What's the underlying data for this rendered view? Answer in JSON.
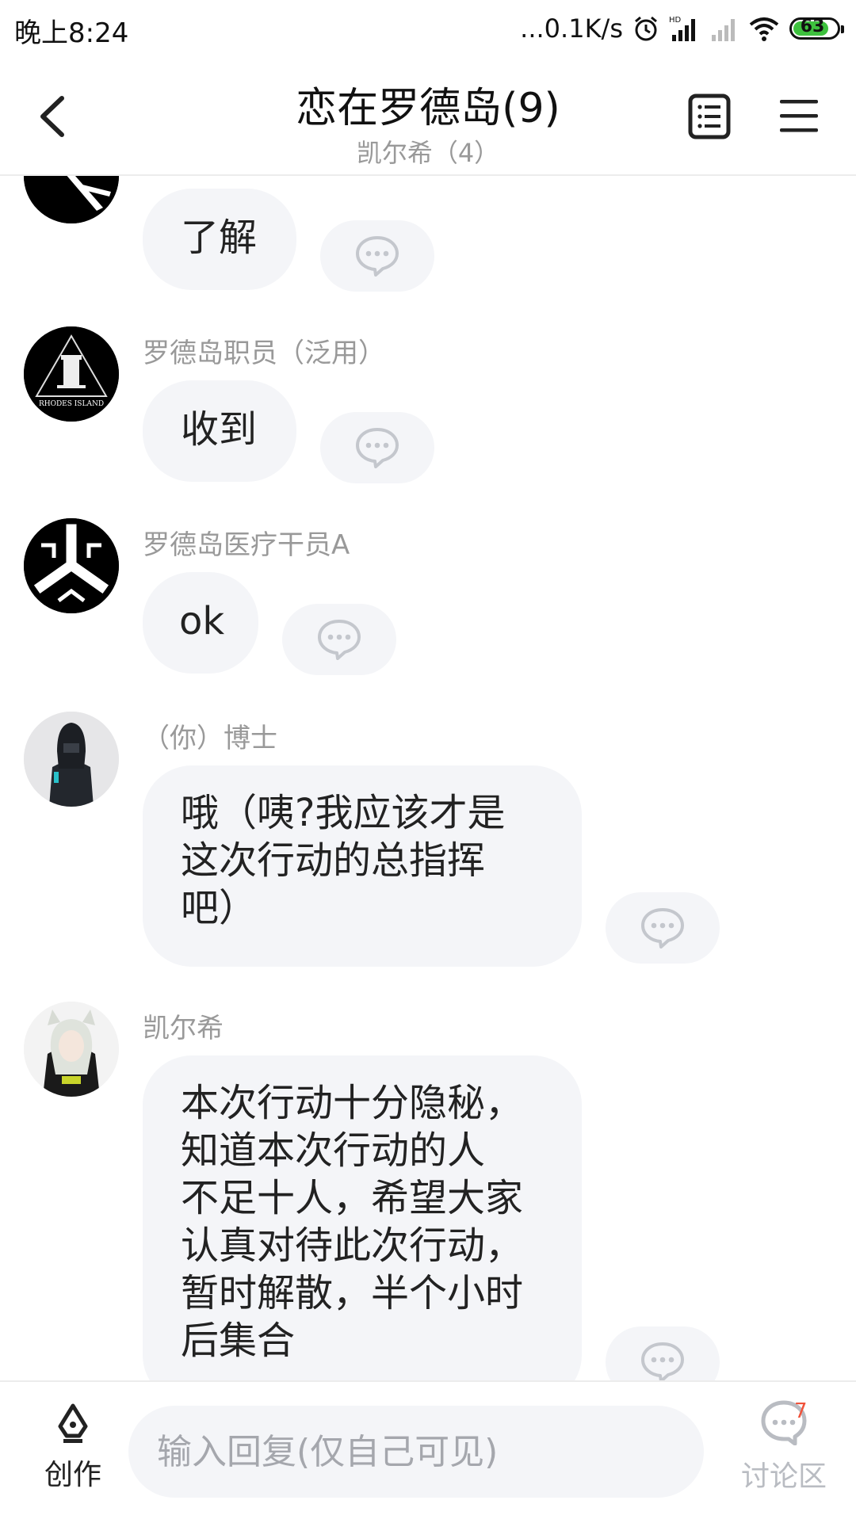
{
  "status_bar": {
    "time": "晚上8:24",
    "network_speed": "...0.1K/s",
    "battery": "63",
    "icons": [
      "alarm-icon",
      "signal-hd-icon",
      "signal-icon",
      "wifi-icon",
      "battery-icon"
    ]
  },
  "header": {
    "title": "恋在罗德岛(9)",
    "subtitle": "凯尔希（4）",
    "icons": [
      "back-icon",
      "list-icon",
      "menu-icon"
    ]
  },
  "messages": [
    {
      "sender": "",
      "text": "了解"
    },
    {
      "sender": "罗德岛职员（泛用）",
      "text": "收到"
    },
    {
      "sender": "罗德岛医疗干员A",
      "text": "ok"
    },
    {
      "sender": "（你）博士",
      "lines": [
        "哦（咦?我应该才是",
        "这次行动的总指挥",
        "吧）"
      ]
    },
    {
      "sender": "凯尔希",
      "lines": [
        "本次行动十分隐秘，",
        "知道本次行动的人",
        "不足十人，希望大家",
        "认真对待此次行动，",
        "暂时解散，半个小时",
        "后集合"
      ]
    }
  ],
  "avatars": {
    "staff_logo_text": "RHODES ISLAND"
  },
  "bottom_bar": {
    "create_label": "创作",
    "reply_placeholder": "输入回复(仅自己可见)",
    "discuss_label": "讨论区",
    "discuss_badge": "7"
  },
  "colors": {
    "bubble_bg": "#f4f5f8",
    "muted_text": "#999999",
    "badge": "#f0533b",
    "battery_fill": "#3ec13e"
  }
}
